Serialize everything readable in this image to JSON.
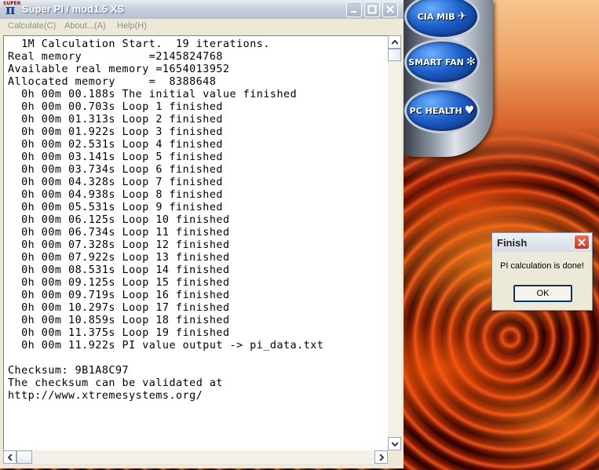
{
  "window": {
    "title": "Super PI / mod1.5 XS",
    "logo_text": "SUPER",
    "logo_glyph": "π"
  },
  "menu": [
    {
      "label": "Calculate(C)"
    },
    {
      "label": "About...(A)"
    },
    {
      "label": "Help(H)"
    }
  ],
  "output": {
    "lines": [
      "  1M Calculation Start.  19 iterations.",
      "Real memory          =2145824768",
      "Available real memory =1654013952",
      "Allocated memory     =  8388648",
      "  0h 00m 00.188s The initial value finished",
      "  0h 00m 00.703s Loop 1 finished",
      "  0h 00m 01.313s Loop 2 finished",
      "  0h 00m 01.922s Loop 3 finished",
      "  0h 00m 02.531s Loop 4 finished",
      "  0h 00m 03.141s Loop 5 finished",
      "  0h 00m 03.734s Loop 6 finished",
      "  0h 00m 04.328s Loop 7 finished",
      "  0h 00m 04.938s Loop 8 finished",
      "  0h 00m 05.531s Loop 9 finished",
      "  0h 00m 06.125s Loop 10 finished",
      "  0h 00m 06.734s Loop 11 finished",
      "  0h 00m 07.328s Loop 12 finished",
      "  0h 00m 07.922s Loop 13 finished",
      "  0h 00m 08.531s Loop 14 finished",
      "  0h 00m 09.125s Loop 15 finished",
      "  0h 00m 09.719s Loop 16 finished",
      "  0h 00m 10.297s Loop 17 finished",
      "  0h 00m 10.859s Loop 18 finished",
      "  0h 00m 11.375s Loop 19 finished",
      "  0h 00m 11.922s PI value output -> pi_data.txt",
      "",
      "Checksum: 9B1A8C97",
      "The checksum can be validated at",
      "http://www.xtremesystems.org/"
    ]
  },
  "launcher": {
    "buttons": [
      {
        "label": "CIA MIB"
      },
      {
        "label": "SMART FAN"
      },
      {
        "label": "PC HEALTH"
      }
    ]
  },
  "dialog": {
    "title": "Finish",
    "message": "PI calculation is done!",
    "ok_label": "OK"
  },
  "colors": {
    "titlebar": "#c9d1dd",
    "dialog_close": "#c0391f",
    "lava": "#e2501a"
  }
}
